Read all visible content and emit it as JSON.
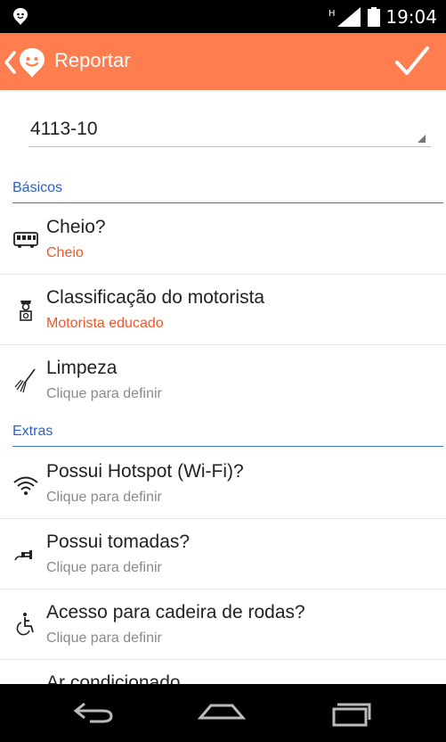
{
  "status_bar": {
    "time": "19:04",
    "network_label": "H",
    "icons": [
      "app-notification-icon",
      "signal-icon",
      "battery-icon"
    ]
  },
  "action_bar": {
    "title": "Reportar",
    "up_icon": "chevron-left-icon",
    "app_icon": "location-pin-icon",
    "confirm_icon": "checkmark-icon",
    "color": "#ff7d4f"
  },
  "line_selector": {
    "value": "4113-10"
  },
  "sections": [
    {
      "header": "Básicos",
      "items": [
        {
          "title": "Cheio?",
          "subtitle": "Cheio",
          "icon": "bus-icon",
          "is_set": true
        },
        {
          "title": "Classificação do motorista",
          "subtitle": "Motorista educado",
          "icon": "driver-icon",
          "is_set": true
        },
        {
          "title": "Limpeza",
          "subtitle": "Clique para definir",
          "icon": "broom-icon",
          "is_set": false
        }
      ]
    },
    {
      "header": "Extras",
      "items": [
        {
          "title": "Possui Hotspot (Wi-Fi)?",
          "subtitle": "Clique para definir",
          "icon": "wifi-icon",
          "is_set": false
        },
        {
          "title": "Possui tomadas?",
          "subtitle": "Clique para definir",
          "icon": "power-plug-icon",
          "is_set": false
        },
        {
          "title": "Acesso para cadeira de rodas?",
          "subtitle": "Clique para definir",
          "icon": "wheelchair-icon",
          "is_set": false
        },
        {
          "title": "Ar condicionado",
          "subtitle": "",
          "icon": "air-conditioning-icon",
          "is_set": false
        }
      ]
    }
  ],
  "nav_bar": {
    "buttons": [
      "back-icon",
      "home-icon",
      "recent-apps-icon"
    ]
  },
  "colors": {
    "accent": "#ff7d4f",
    "section_header": "#2a5fc9",
    "set_value": "#f2552c",
    "hint": "#8a8a8a"
  }
}
